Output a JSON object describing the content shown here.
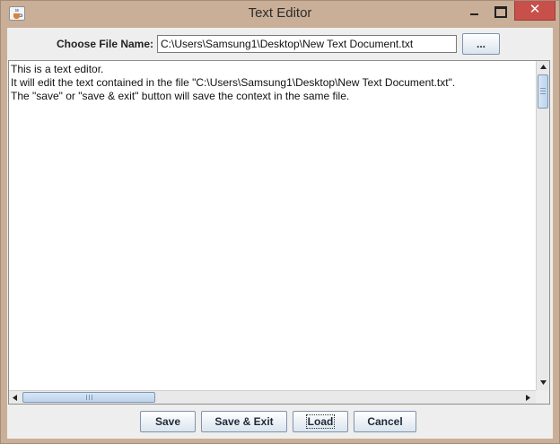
{
  "window": {
    "title": "Text Editor",
    "close_glyph": "✕"
  },
  "file_chooser": {
    "label": "Choose File Name:",
    "path_value": "C:\\Users\\Samsung1\\Desktop\\New Text Document.txt",
    "browse_label": "..."
  },
  "editor": {
    "lines": [
      "This is a text editor.",
      "It will edit the text contained in the file \"C:\\Users\\Samsung1\\Desktop\\New Text Document.txt\".",
      "The \"save\" or \"save & exit\" button will save the context in the same file."
    ]
  },
  "buttons": {
    "save": "Save",
    "save_exit": "Save & Exit",
    "load": "Load",
    "cancel": "Cancel"
  },
  "colors": {
    "title_bar": "#c9af97",
    "close_button": "#c7504b",
    "panel": "#eeeeee",
    "button_border": "#7f93aa"
  },
  "icons": {
    "app": "java-cup-icon",
    "minimize": "minimize-icon",
    "maximize": "maximize-icon",
    "close": "close-icon"
  }
}
